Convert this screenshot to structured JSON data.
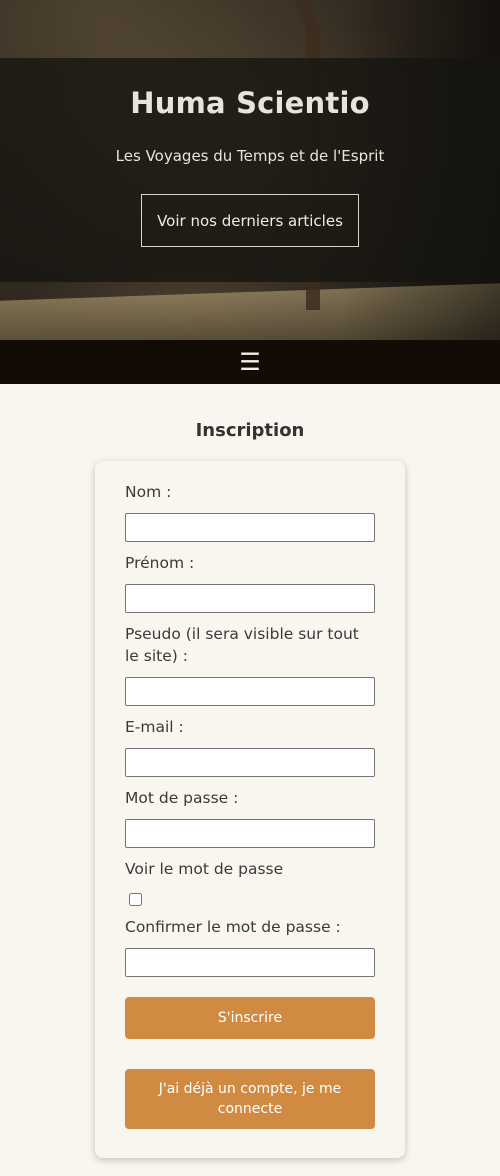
{
  "hero": {
    "title": "Huma Scientio",
    "subtitle": "Les Voyages du Temps et de l'Esprit",
    "cta_label": "Voir nos derniers articles"
  },
  "nav": {
    "menu_icon": "hamburger-icon",
    "menu_glyph": "☰"
  },
  "form": {
    "title": "Inscription",
    "fields": {
      "nom": {
        "label": "Nom :",
        "value": ""
      },
      "prenom": {
        "label": "Prénom :",
        "value": ""
      },
      "pseudo": {
        "label": "Pseudo (il sera visible sur tout le site) :",
        "value": ""
      },
      "email": {
        "label": "E-mail :",
        "value": ""
      },
      "password": {
        "label": "Mot de passe :",
        "value": ""
      },
      "show_password": {
        "label": "Voir le mot de passe",
        "checked": false
      },
      "confirm_password": {
        "label": "Confirmer le mot de passe :",
        "value": ""
      }
    },
    "submit_label": "S'inscrire",
    "login_label": "J'ai déjà un compte, je me connecte"
  },
  "colors": {
    "accent": "#d08a42",
    "nav_background": "#130b06",
    "page_background": "#f9f6ef"
  }
}
